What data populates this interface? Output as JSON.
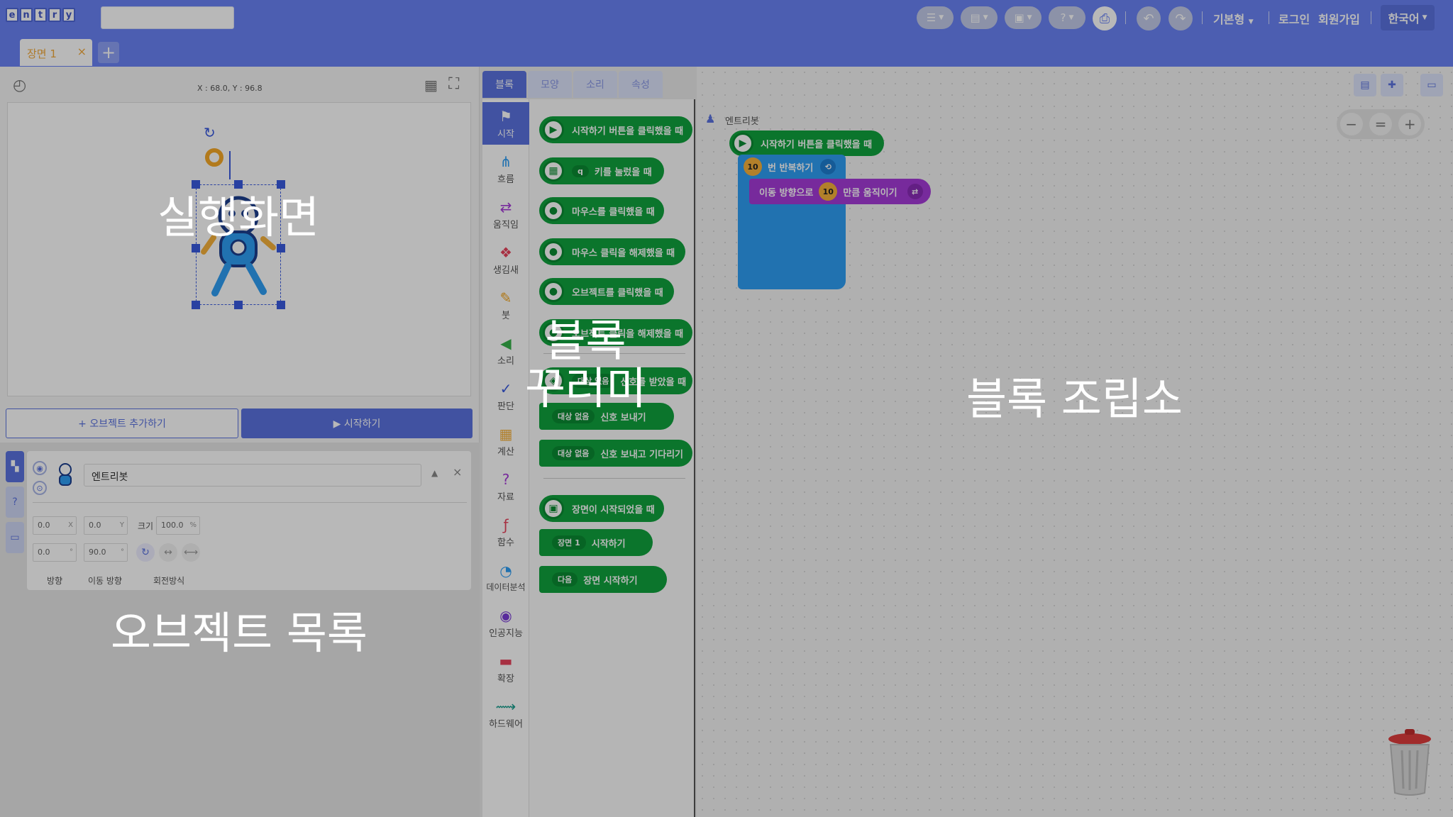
{
  "topbar": {
    "logo_letters": [
      "e",
      "n",
      "t",
      "r",
      "y"
    ],
    "project_name": "",
    "mode_label": "기본형",
    "login_label": "로그인",
    "signup_label": "회원가입",
    "language_label": "한국어"
  },
  "scene": {
    "tab_label": "장면 1",
    "close_glyph": "×",
    "add_glyph": "+"
  },
  "stage": {
    "coordinates": "X : 68.0, Y : 96.8",
    "add_object_label": "+ 오브젝트 추가하기",
    "start_label": "▶ 시작하기"
  },
  "object": {
    "name": "엔트리봇",
    "x": "0.0",
    "x_unit": "X",
    "y": "0.0",
    "y_unit": "Y",
    "size_label": "크기",
    "size": "100.0",
    "size_unit": "%",
    "direction": "0.0",
    "direction_unit": "°",
    "move_direction": "90.0",
    "move_direction_unit": "°",
    "direction_label": "방향",
    "move_direction_label": "이동 방향",
    "rotation_label": "회전방식"
  },
  "palette": {
    "tabs": [
      "블록",
      "모양",
      "소리",
      "속성"
    ],
    "categories": [
      "시작",
      "흐름",
      "움직임",
      "생김새",
      "붓",
      "소리",
      "판단",
      "계산",
      "자료",
      "함수",
      "데이터분석",
      "인공지능",
      "확장",
      "하드웨어"
    ],
    "blocks": {
      "b1": "시작하기 버튼을 클릭했을 때",
      "b2_key": "q",
      "b2": "키를 눌렀을 때",
      "b3": "마우스를 클릭했을 때",
      "b4": "마우스 클릭을 해제했을 때",
      "b5": "오브젝트를 클릭했을 때",
      "b6": "오브젝트 클릭을 해제했을 때",
      "b7_target": "대상 없음",
      "b7": "신호를 받았을 때",
      "b8_target": "대상 없음",
      "b8": "신호 보내기",
      "b9_target": "대상 없음",
      "b9": "신호 보내고 기다리기",
      "b10": "장면이 시작되었을 때",
      "b11_scene": "장면 1",
      "b11": "시작하기",
      "b12_scene": "다음",
      "b12": "장면 시작하기"
    }
  },
  "workspace": {
    "object_label": "엔트리봇",
    "start_block": "시작하기 버튼을 클릭했을 때",
    "repeat_count": "10",
    "repeat_text": "번 반복하기",
    "move_prefix": "이동 방향으로",
    "move_count": "10",
    "move_suffix": "만큼 움직이기"
  },
  "overlay_labels": {
    "stage": "실행화면",
    "palette_line1": "블록",
    "palette_line2": "꾸러미",
    "workspace": "블록 조립소",
    "objects": "오브젝트 목록"
  },
  "colors": {
    "topbar": "#6a83f5",
    "accent": "#5a72e0",
    "start_block": "#10a33d",
    "repeat_block": "#2f9ef4",
    "move_block": "#a63bd8"
  },
  "icons": [
    "gauge-icon",
    "grid-icon",
    "fullscreen-icon",
    "undo-icon",
    "redo-icon",
    "print-icon",
    "help-icon",
    "trash-icon"
  ]
}
